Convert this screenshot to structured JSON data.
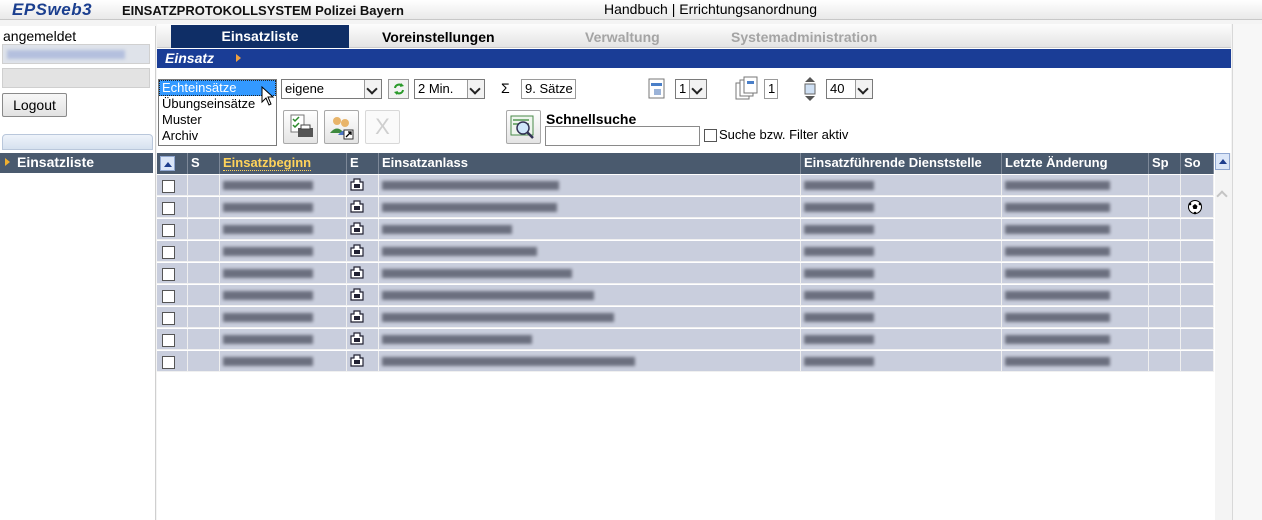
{
  "header": {
    "logo": "EPSweb3",
    "title": "EINSATZPROTOKOLLSYSTEM Polizei Bayern",
    "handbook": "Handbuch",
    "separator": " | ",
    "order": "Errichtungsanordnung"
  },
  "sidebar": {
    "login_label": "angemeldet",
    "logout_label": "Logout",
    "nav_item": "Einsatzliste"
  },
  "menu": [
    {
      "label": "Einsatzliste",
      "state": "active"
    },
    {
      "label": "Voreinstellungen",
      "state": "normal"
    },
    {
      "label": "Verwaltung",
      "state": "disabled"
    },
    {
      "label": "Systemadministration",
      "state": "disabled"
    }
  ],
  "section": {
    "title": "Einsatz"
  },
  "toolbar": {
    "type_list": [
      "Echteinsätze",
      "Übungseinsätze",
      "Muster",
      "Archiv"
    ],
    "type_selected": "Echteinsätze",
    "owner_select": "eigene",
    "refresh_icon": "refresh-icon",
    "interval_select": "2 Min.",
    "sigma": "Σ",
    "record_count": "9. Sätze",
    "page_select": "1",
    "page_count": "1",
    "rows_select": "40",
    "quick_search_label": "Schnellsuche",
    "quick_search_value": "",
    "filter_label": "Suche bzw. Filter aktiv",
    "filter_checked": false
  },
  "table": {
    "columns": [
      "S",
      "Einsatzbeginn",
      "E",
      "Einsatzanlass",
      "Einsatzführende Dienststelle",
      "Letzte Änderung",
      "Sp",
      "So"
    ],
    "sorted_column": "Einsatzbeginn",
    "rows": [
      {
        "so_icon": false
      },
      {
        "so_icon": true
      },
      {
        "so_icon": false
      },
      {
        "so_icon": false
      },
      {
        "so_icon": false
      },
      {
        "so_icon": false
      },
      {
        "so_icon": false
      },
      {
        "so_icon": false
      },
      {
        "so_icon": false
      }
    ]
  },
  "colors": {
    "menu_active": "#0f2e66",
    "section_bar": "#1a3d96",
    "table_header": "#4a5a6e",
    "row_bg": "#c9cedd",
    "sorted_header_text": "#ffd35a"
  }
}
